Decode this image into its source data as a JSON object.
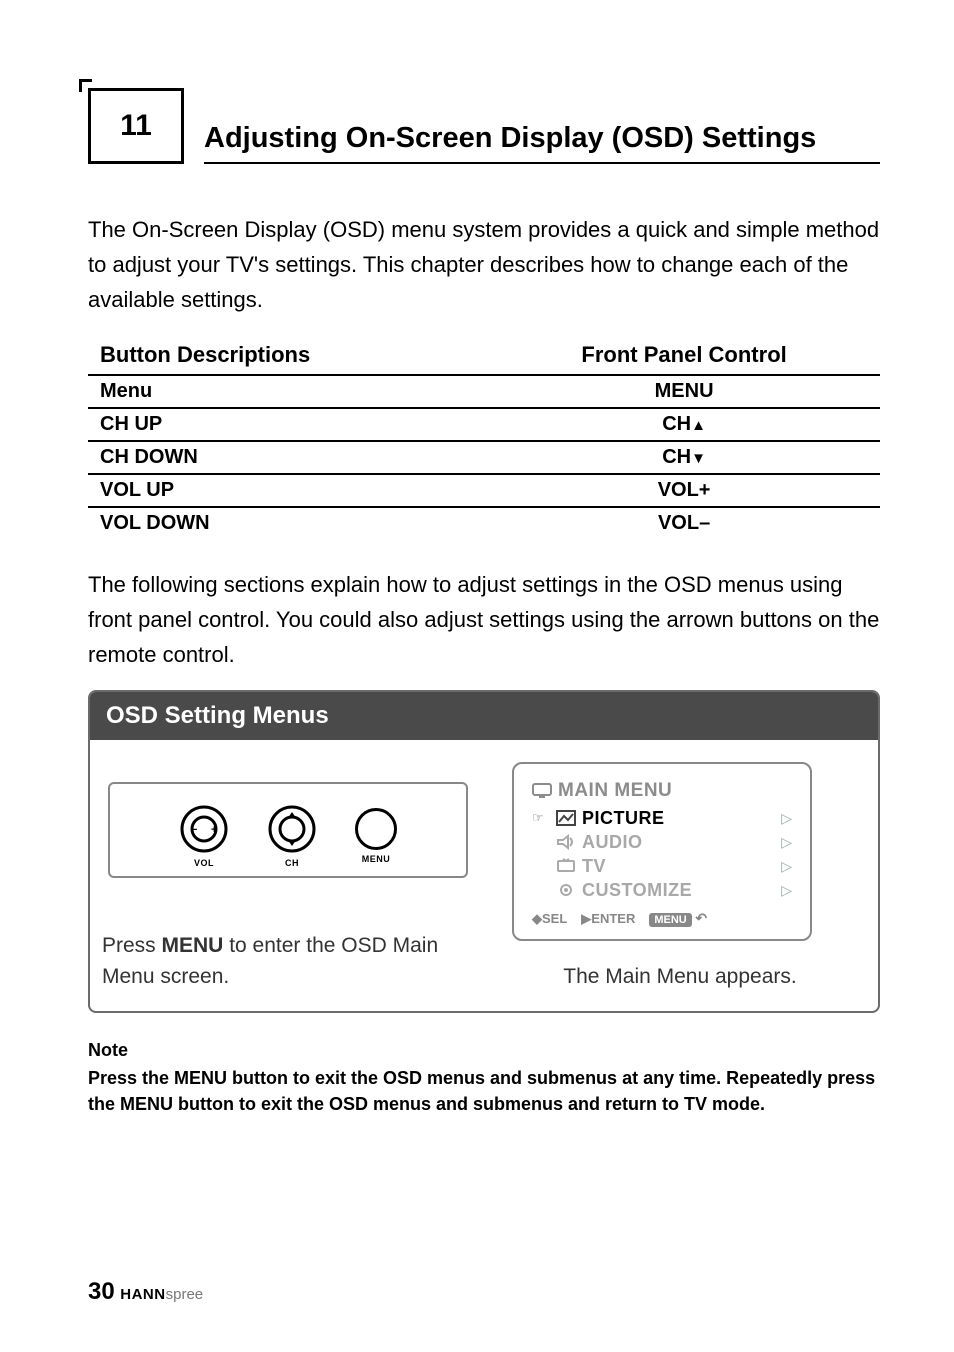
{
  "chapter": {
    "number": "11",
    "title": "Adjusting On-Screen Display (OSD) Settings"
  },
  "intro": "The On-Screen Display (OSD) menu system provides a quick and simple method to adjust your TV's settings. This chapter describes how to change each of the available settings.",
  "button_table": {
    "headers": {
      "desc": "Button Descriptions",
      "fpc": "Front Panel Control"
    },
    "rows": [
      {
        "desc": "Menu",
        "fpc": "MENU"
      },
      {
        "desc": "CH UP",
        "fpc": "CH",
        "suffix": "up"
      },
      {
        "desc": "CH DOWN",
        "fpc": "CH",
        "suffix": "down"
      },
      {
        "desc": "VOL UP",
        "fpc": "VOL+"
      },
      {
        "desc": "VOL DOWN",
        "fpc": "VOL–"
      }
    ]
  },
  "para2": "The following sections explain how to adjust settings in the OSD menus using front panel control. You could also adjust settings using the arrown buttons on the remote control.",
  "osd": {
    "heading": "OSD Setting Menus",
    "panel_labels": {
      "vol": "VOL",
      "ch": "CH",
      "menu": "MENU"
    },
    "left_caption_prefix": "Press ",
    "left_caption_bold": "MENU",
    "left_caption_suffix": " to enter the OSD Main Menu screen.",
    "right_caption": "The Main Menu appears.",
    "menu": {
      "title": "MAIN  MENU",
      "items": [
        {
          "label": "PICTURE",
          "selected": true
        },
        {
          "label": "AUDIO",
          "selected": false
        },
        {
          "label": "TV",
          "selected": false
        },
        {
          "label": "CUSTOMIZE",
          "selected": false
        }
      ],
      "foot": {
        "sel": "SEL",
        "enter": "ENTER",
        "menu": "MENU"
      }
    }
  },
  "note": {
    "heading": "Note",
    "body": "Press the MENU button to exit the OSD menus and submenus at any time. Repeatedly press the MENU button to exit the OSD menus and submenus and return to TV mode."
  },
  "footer": {
    "page": "30",
    "brand1": "HANN",
    "brand2": "spree"
  }
}
